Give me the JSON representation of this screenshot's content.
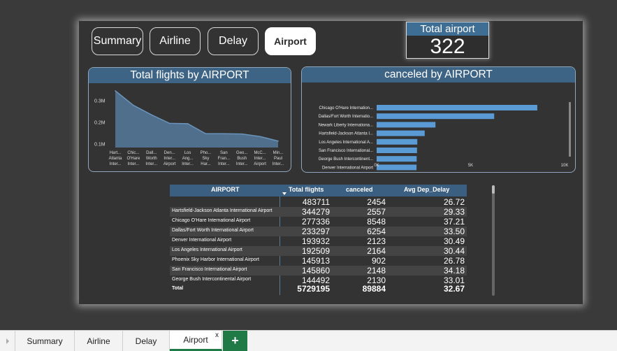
{
  "nav": {
    "summary": "Summary",
    "airline": "Airline",
    "delay": "Delay",
    "airport": "Airport"
  },
  "kpi": {
    "title": "Total airport",
    "value": "322"
  },
  "chart_data": [
    {
      "type": "area",
      "title": "Total flights by AIRPORT",
      "categories": [
        "Hart... Atlanta Inter...",
        "Chic... O'Hare Inter...",
        "Dall... Worth Inter...",
        "Den... Inter... Airport",
        "Los Ang... Inter...",
        "Pho... Sky Har...",
        "San Fran... Inter...",
        "Geo... Bush Inter...",
        "McC... Inter... Airport",
        "Min... Paul Inter..."
      ],
      "values": [
        344279,
        277336,
        233297,
        193932,
        192509,
        145913,
        145860,
        144492,
        133000,
        112000
      ],
      "yticks": [
        "0.3M",
        "0.2M",
        "0.1M"
      ],
      "ytick_values": [
        300000,
        200000,
        100000
      ],
      "ylim": [
        82000,
        360000
      ],
      "color": "#5b84ab"
    },
    {
      "type": "bar",
      "title": "canceled by AIRPORT",
      "categories": [
        "Chicago O'Hare Internation...",
        "Dallas/Fort Worth Internatio...",
        "Newark Liberty Internationa...",
        "Hartsfield-Jackson Atlanta I...",
        "Los Angeles International A...",
        "San Francisco International...",
        "George Bush Intercontinent...",
        "Denver International Airport"
      ],
      "values": [
        8548,
        6254,
        3130,
        2557,
        2164,
        2148,
        2130,
        2123
      ],
      "xticks": [
        "0K",
        "5K",
        "10K"
      ],
      "xtick_values": [
        0,
        5000,
        10000
      ],
      "xlim": [
        0,
        10000
      ],
      "color": "#5b9bd5"
    }
  ],
  "table": {
    "headers": [
      "AIRPORT",
      "Total flights",
      "canceled",
      "Avg Dep_Delay"
    ],
    "rows": [
      {
        "airport": "",
        "flights": "483711",
        "canceled": "2454",
        "delay": "26.72"
      },
      {
        "airport": "Hartsfield-Jackson Atlanta International Airport",
        "flights": "344279",
        "canceled": "2557",
        "delay": "29.33"
      },
      {
        "airport": "Chicago O'Hare International Airport",
        "flights": "277336",
        "canceled": "8548",
        "delay": "37.21"
      },
      {
        "airport": "Dallas/Fort Worth International Airport",
        "flights": "233297",
        "canceled": "6254",
        "delay": "33.50"
      },
      {
        "airport": "Denver International Airport",
        "flights": "193932",
        "canceled": "2123",
        "delay": "30.49"
      },
      {
        "airport": "Los Angeles International Airport",
        "flights": "192509",
        "canceled": "2164",
        "delay": "30.44"
      },
      {
        "airport": "Phoenix Sky Harbor International Airport",
        "flights": "145913",
        "canceled": "902",
        "delay": "26.78"
      },
      {
        "airport": "San Francisco International Airport",
        "flights": "145860",
        "canceled": "2148",
        "delay": "34.18"
      },
      {
        "airport": "George Bush Intercontinental Airport",
        "flights": "144492",
        "canceled": "2130",
        "delay": "33.01"
      }
    ],
    "total": {
      "label": "Total",
      "flights": "5729195",
      "canceled": "89884",
      "delay": "32.67"
    }
  },
  "sheets": {
    "tabs": [
      "Summary",
      "Airline",
      "Delay",
      "Airport"
    ],
    "active": "Airport",
    "close_glyph": "x",
    "add_glyph": "+"
  }
}
